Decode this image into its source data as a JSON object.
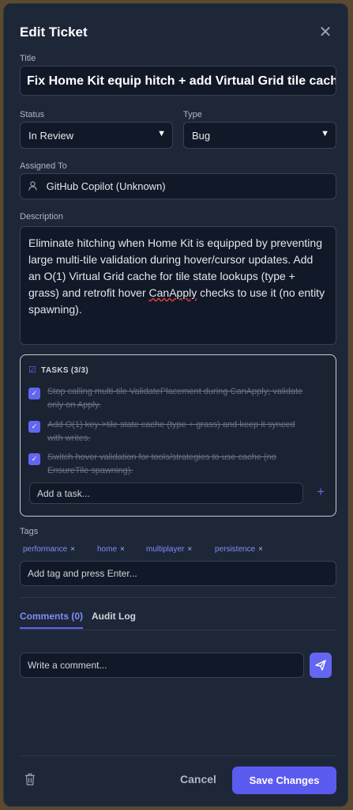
{
  "modal": {
    "title": "Edit Ticket",
    "close_icon": "close-icon"
  },
  "fields": {
    "title_label": "Title",
    "title_value": "Fix Home Kit equip hitch + add Virtual Grid tile cache",
    "status_label": "Status",
    "status_value": "In Review",
    "type_label": "Type",
    "type_value": "Bug",
    "assigned_label": "Assigned To",
    "assigned_value": "GitHub Copilot (Unknown)",
    "description_label": "Description",
    "description_pre": "Eliminate hitching when Home Kit is equipped by preventing large multi-tile validation during hover/cursor updates. Add an O(1) Virtual Grid cache for tile state lookups (type + grass) and retrofit hover ",
    "description_misspelled": "CanApply",
    "description_post": " checks to use it (no entity spawning)."
  },
  "tasks": {
    "header": "TASKS (3/3)",
    "items": [
      {
        "label": "Stop calling multi-tile ValidatePlacement during CanApply; validate only on Apply.",
        "done": true
      },
      {
        "label": "Add O(1) key->tile state cache (type + grass) and keep it synced with writes.",
        "done": true
      },
      {
        "label": "Switch hover validation for tools/strategies to use cache (no EnsureTile spawning).",
        "done": true
      }
    ],
    "add_placeholder": "Add a task..."
  },
  "tags": {
    "label": "Tags",
    "items": [
      "performance",
      "home",
      "multiplayer",
      "persistence"
    ],
    "remove_symbol": "×",
    "input_placeholder": "Add tag and press Enter..."
  },
  "tabs": {
    "comments": "Comments (0)",
    "audit": "Audit Log"
  },
  "comment": {
    "placeholder": "Write a comment..."
  },
  "footer": {
    "cancel": "Cancel",
    "save": "Save Changes"
  },
  "colors": {
    "accent": "#6366f1",
    "panel": "#1e2738",
    "input_bg": "#111827"
  }
}
